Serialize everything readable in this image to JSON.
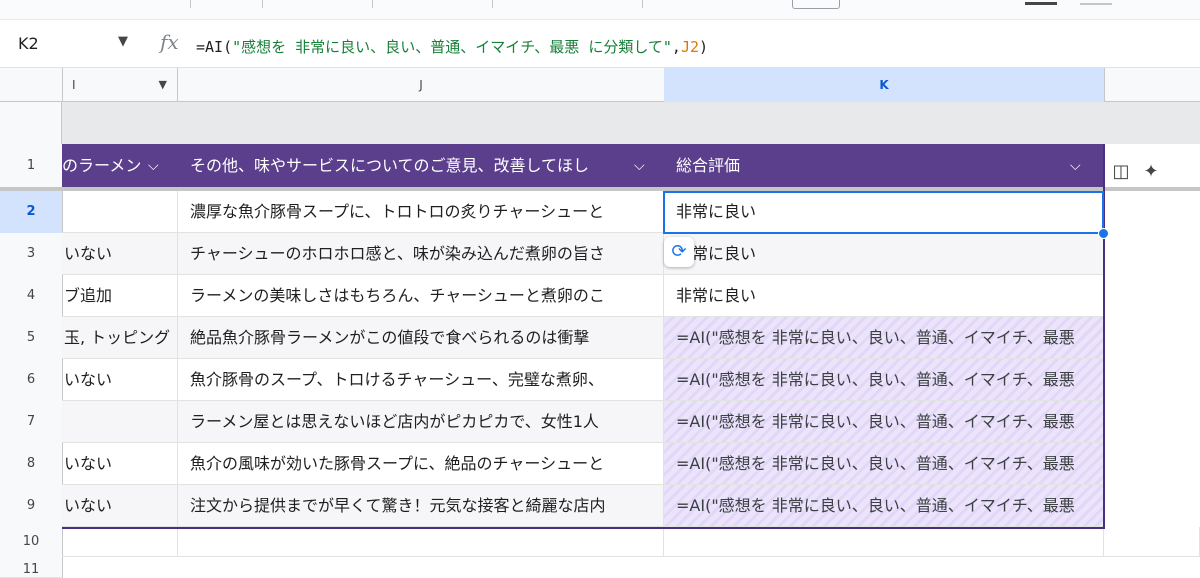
{
  "formula_bar": {
    "name_box": "K2",
    "fx_label": "fx",
    "formula_prefix": "=AI(",
    "formula_string": "\"感想を 非常に良い、良い、普通、イマイチ、最悪 に分類して\"",
    "formula_comma": ",",
    "formula_ref": "J2",
    "formula_suffix": ")"
  },
  "columns": {
    "i": "I",
    "j": "J",
    "k": "K"
  },
  "table_header": {
    "col_i": "のラーメン",
    "col_j": "その他、味やサービスについてのご意見、改善してほし",
    "col_k": "総合評価"
  },
  "rows": [
    {
      "num": "2",
      "i": "",
      "j": "濃厚な魚介豚骨スープに、トロトロの炙りチャーシューと",
      "k": "非常に良い"
    },
    {
      "num": "3",
      "i": "いない",
      "j": "チャーシューのホロホロ感と、味が染み込んだ煮卵の旨さ",
      "k": "非常に良い"
    },
    {
      "num": "4",
      "i": "ブ追加",
      "j": "ラーメンの美味しさはもちろん、チャーシューと煮卵のこ",
      "k": "非常に良い"
    },
    {
      "num": "5",
      "i": "玉, トッピング",
      "j": "絶品魚介豚骨ラーメンがこの値段で食べられるのは衝撃",
      "k": "=AI(\"感想を 非常に良い、良い、普通、イマイチ、最悪"
    },
    {
      "num": "6",
      "i": "いない",
      "j": "魚介豚骨のスープ、トロけるチャーシュー、完璧な煮卵、",
      "k": "=AI(\"感想を 非常に良い、良い、普通、イマイチ、最悪"
    },
    {
      "num": "7",
      "i": "",
      "j": "ラーメン屋とは思えないほど店内がピカピカで、女性1人",
      "k": "=AI(\"感想を 非常に良い、良い、普通、イマイチ、最悪"
    },
    {
      "num": "8",
      "i": "いない",
      "j": "魚介の風味が効いた豚骨スープに、絶品のチャーシューと",
      "k": "=AI(\"感想を 非常に良い、良い、普通、イマイチ、最悪"
    },
    {
      "num": "9",
      "i": "いない",
      "j": "注文から提供までが早くて驚き！元気な接客と綺麗な店内",
      "k": "=AI(\"感想を 非常に良い、良い、普通、イマイチ、最悪"
    }
  ],
  "row_numbers": {
    "r1": "1",
    "r10": "10",
    "r11": "11"
  },
  "icons": {
    "refresh": "refresh-icon",
    "table-layout": "table-layout-icon",
    "gemini": "sparkle-icon",
    "dropdown": "chevron-down-icon"
  },
  "colors": {
    "table_header": "#5b3f8c",
    "selection": "#1a73e8",
    "ai_pending": "#ebe4fa",
    "highlight_underline": "#e53935"
  }
}
